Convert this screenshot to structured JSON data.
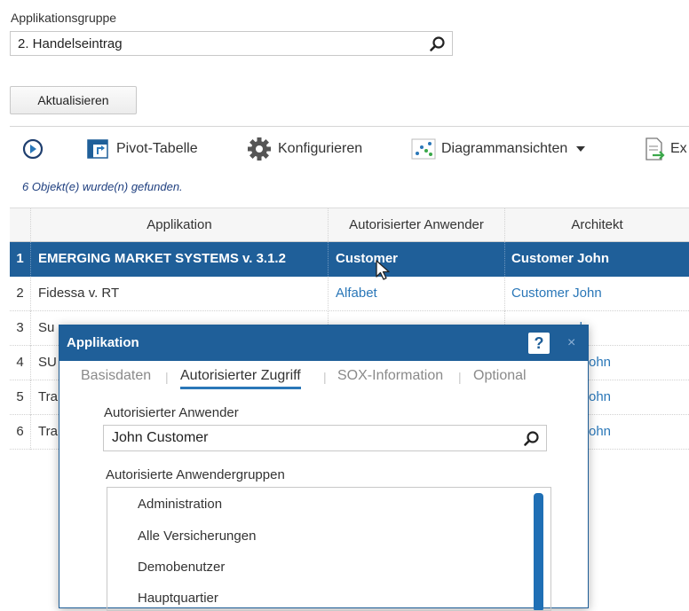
{
  "filter": {
    "label": "Applikationsgruppe",
    "value": "2. Handelseintrag",
    "refresh_label": "Aktualisieren"
  },
  "toolbar": {
    "pivot_label": "Pivot-Tabelle",
    "configure_label": "Konfigurieren",
    "charts_label": "Diagrammansichten",
    "export_label": "Ex"
  },
  "status": {
    "found_text": "6 Objekt(e) wurde(n) gefunden."
  },
  "table": {
    "headers": {
      "application": "Applikation",
      "user": "Autorisierter Anwender",
      "architect": "Architekt"
    },
    "rows": [
      {
        "num": "1",
        "application": "EMERGING MARKET SYSTEMS v. 3.1.2",
        "user": "Customer",
        "architect": "Customer John"
      },
      {
        "num": "2",
        "application": "Fidessa v. RT",
        "user": "Alfabet",
        "architect": "Customer John"
      },
      {
        "num": "3",
        "application": "Su",
        "user": "",
        "architect": "arek"
      },
      {
        "num": "4",
        "application": "SU",
        "user": "",
        "architect": "ohn"
      },
      {
        "num": "5",
        "application": "Tra",
        "user": "",
        "architect": "ohn"
      },
      {
        "num": "6",
        "application": "Tra",
        "user": "",
        "architect": "ohn"
      }
    ]
  },
  "dialog": {
    "title": "Applikation",
    "help_label": "?",
    "close_label": "×",
    "tabs": [
      "Basisdaten",
      "Autorisierter Zugriff",
      "SOX-Information",
      "Optional"
    ],
    "user_label": "Autorisierter Anwender",
    "user_value": "John Customer",
    "groups_label": "Autorisierte Anwendergruppen",
    "groups": [
      "Administration",
      "Alle Versicherungen",
      "Demobenutzer",
      "Hauptquartier"
    ]
  },
  "colors": {
    "accent": "#1f5f99",
    "link": "#2a77b8"
  }
}
